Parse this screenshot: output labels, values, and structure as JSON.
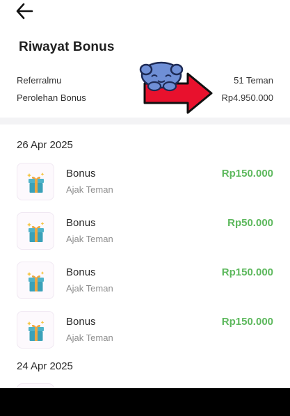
{
  "header": {
    "title": "Riwayat Bonus"
  },
  "summary": {
    "referral_label": "Referralmu",
    "referral_value": "51 Teman",
    "bonus_label": "Perolehan Bonus",
    "bonus_value": "Rp4.950.000"
  },
  "groups": [
    {
      "date": "26 Apr 2025",
      "items": [
        {
          "title": "Bonus",
          "subtitle": "Ajak Teman",
          "amount": "Rp150.000"
        },
        {
          "title": "Bonus",
          "subtitle": "Ajak Teman",
          "amount": "Rp50.000"
        },
        {
          "title": "Bonus",
          "subtitle": "Ajak Teman",
          "amount": "Rp150.000"
        },
        {
          "title": "Bonus",
          "subtitle": "Ajak Teman",
          "amount": "Rp150.000"
        }
      ]
    },
    {
      "date": "24 Apr 2025"
    }
  ],
  "icons": {
    "back": "arrow-left-icon",
    "gift": "gift-icon",
    "mascot": "mascot-arrow-sticker"
  },
  "colors": {
    "amount": "#5cb85c",
    "accent_red": "#e8112d",
    "mascot_blue": "#6f8fd6"
  }
}
